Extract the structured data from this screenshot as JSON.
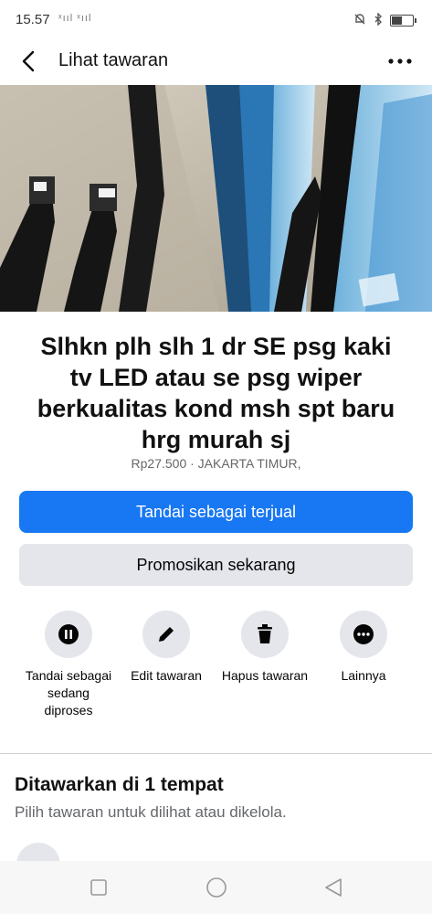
{
  "status_bar": {
    "time": "15.57",
    "signal_text": "ˣııl ˣııl"
  },
  "header": {
    "title": "Lihat tawaran"
  },
  "gallery": {
    "photo_count": 6,
    "active_index": 0
  },
  "listing": {
    "title": "Slhkn plh slh 1 dr SE psg kaki tv LED atau se psg wiper berkualitas kond msh spt baru hrg murah sj",
    "meta": "Rp27.500 · JAKARTA TIMUR,"
  },
  "buttons": {
    "mark_sold": "Tandai sebagai terjual",
    "promote": "Promosikan sekarang"
  },
  "actions": [
    {
      "label": "Tandai sebagai sedang diproses",
      "icon": "pause-icon"
    },
    {
      "label": "Edit tawaran",
      "icon": "pencil-icon"
    },
    {
      "label": "Hapus tawaran",
      "icon": "trash-icon"
    },
    {
      "label": "Lainnya",
      "icon": "more-icon"
    }
  ],
  "section": {
    "title": "Ditawarkan di 1 tempat",
    "subtitle": "Pilih tawaran untuk dilihat atau dikelola."
  },
  "colors": {
    "primary": "#1877f2",
    "secondary_bg": "#e4e6eb",
    "muted_text": "#65676b"
  }
}
